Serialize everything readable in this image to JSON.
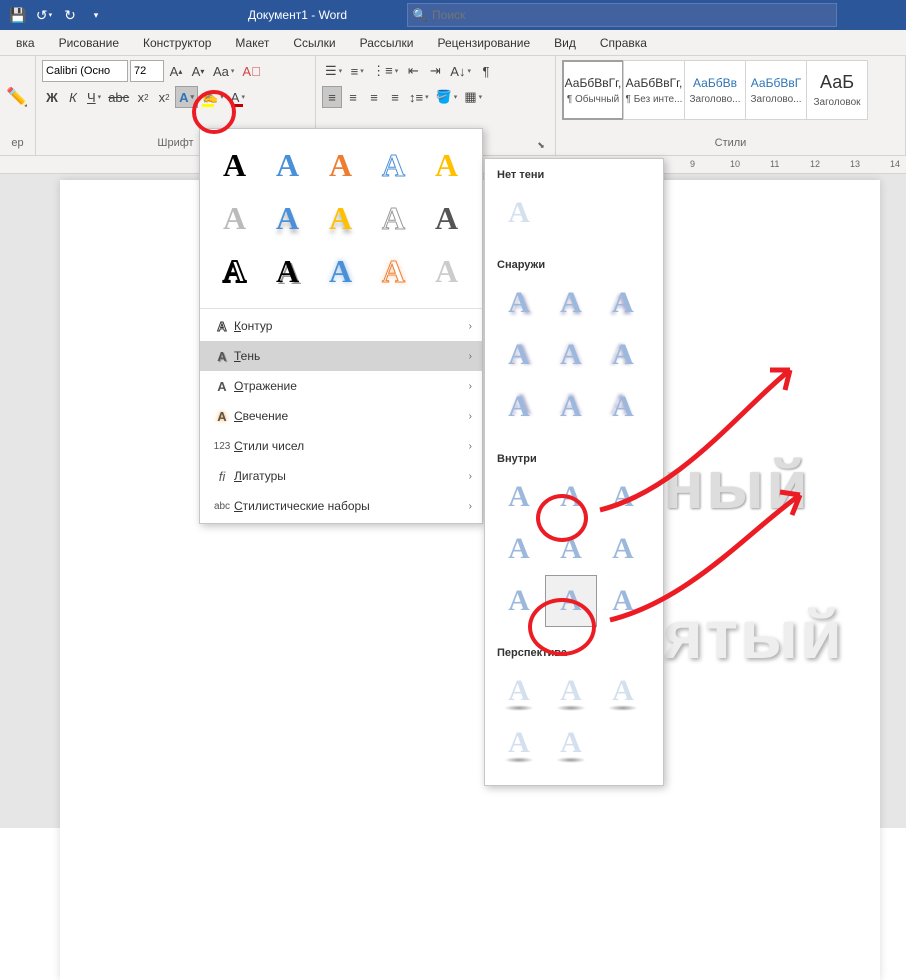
{
  "titlebar": {
    "doc_title": "Документ1 - Word",
    "search_placeholder": "Поиск"
  },
  "tabs": [
    "вка",
    "Рисование",
    "Конструктор",
    "Макет",
    "Ссылки",
    "Рассылки",
    "Рецензирование",
    "Вид",
    "Справка"
  ],
  "ribbon": {
    "clipboard_group": "ер",
    "font": {
      "name": "Calibri (Осно",
      "size": "72",
      "group_label": "Шрифт"
    },
    "paragraph_group": "",
    "styles": {
      "group_label": "Стили",
      "items": [
        {
          "preview": "АаБбВвГг,",
          "name": "¶ Обычный",
          "color": ""
        },
        {
          "preview": "АаБбВвГг,",
          "name": "¶ Без инте...",
          "color": ""
        },
        {
          "preview": "АаБбВв",
          "name": "Заголово...",
          "color": "blue"
        },
        {
          "preview": "АаБбВвГ",
          "name": "Заголово...",
          "color": "blue"
        },
        {
          "preview": "АаБ",
          "name": "Заголовок",
          "color": ""
        }
      ]
    }
  },
  "fx_gallery": {
    "menu": [
      {
        "icon": "A",
        "label": "Контур",
        "key": "К"
      },
      {
        "icon": "A",
        "label": "Тень",
        "key": "Т",
        "hl": true
      },
      {
        "icon": "A",
        "label": "Отражение",
        "key": "О"
      },
      {
        "icon": "A",
        "label": "Свечение",
        "key": "С"
      },
      {
        "icon": "123",
        "label": "Стили чисел",
        "key": "С"
      },
      {
        "icon": "fi",
        "label": "Лигатуры",
        "key": "Л"
      },
      {
        "icon": "abc",
        "label": "Стилистические наборы",
        "key": "С"
      }
    ]
  },
  "shadow_menu": {
    "sections": {
      "none": "Нет тени",
      "outer": "Снаружи",
      "inner": "Внутри",
      "perspective": "Перспектива"
    }
  },
  "doc_text": {
    "line1": "нный",
    "line2": "нятый"
  },
  "ruler_marks": [
    "9",
    "10",
    "11",
    "12",
    "13",
    "14"
  ]
}
